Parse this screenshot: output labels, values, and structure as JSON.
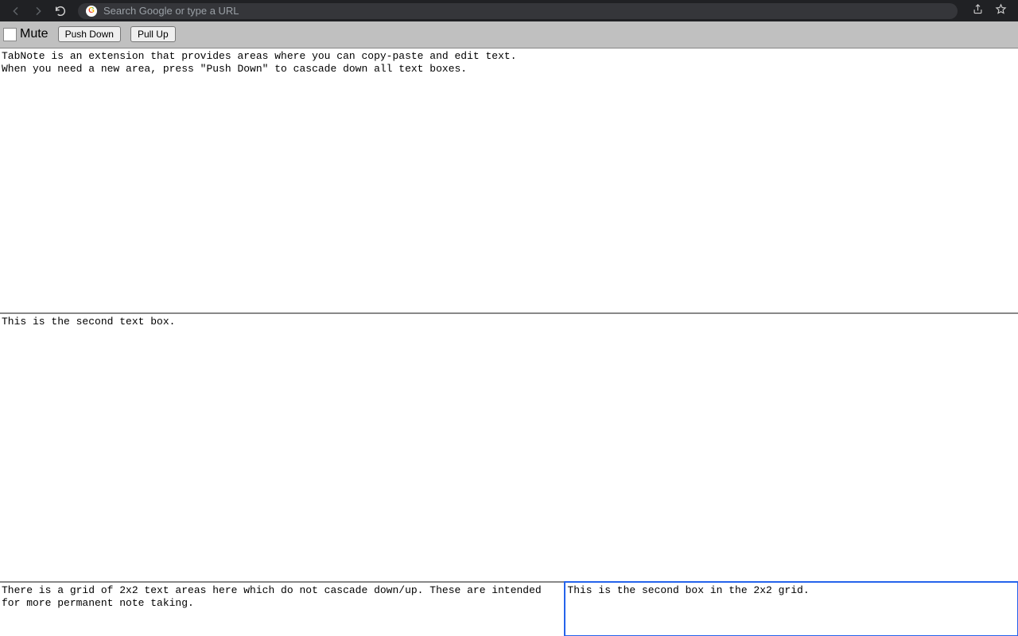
{
  "chrome": {
    "omnibox_placeholder": "Search Google or type a URL"
  },
  "toolbar": {
    "mute_label": "Mute",
    "push_down_label": "Push Down",
    "pull_up_label": "Pull Up"
  },
  "textboxes": {
    "box1": "TabNote is an extension that provides areas where you can copy-paste and edit text.\nWhen you need a new area, press \"Push Down\" to cascade down all text boxes.",
    "box2": "This is the second text box.",
    "grid_left": "There is a grid of 2x2 text areas here which do not cascade down/up. These are intended for more permanent note taking.",
    "grid_right": "This is the second box in the 2x2 grid."
  }
}
